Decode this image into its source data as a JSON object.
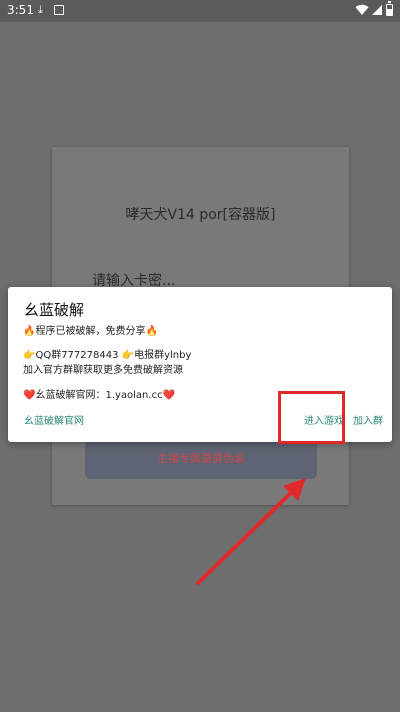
{
  "status_bar": {
    "time": "3:51",
    "icons": [
      "download-icon",
      "image-icon",
      "wifi-icon",
      "signal-icon",
      "battery-icon"
    ]
  },
  "background_card": {
    "title": "哮天犬V14 por[容器版]",
    "input_placeholder": "请输入卡密...",
    "button_label": "主播专属录屏伪装"
  },
  "dialog": {
    "title": "幺蓝破解",
    "line1": "🔥程序已被破解，免费分享🔥",
    "line2": "👉QQ群777278443 👉电报群ylnby",
    "line3": "加入官方群聊获取更多免费破解资源",
    "line4": "❤️幺蓝破解官网：1.yaolan.cc❤️",
    "btn_official": "幺蓝破解官网",
    "btn_enter": "进入游戏",
    "btn_join": "加入群"
  },
  "colors": {
    "overlay": "#6e6e6e",
    "dialog_button_text": "#2b8a7a",
    "highlight": "#e02a2a"
  }
}
